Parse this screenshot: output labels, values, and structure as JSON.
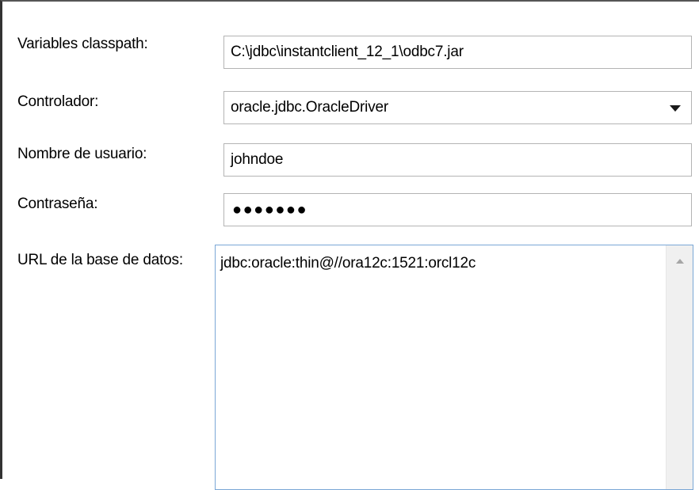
{
  "form": {
    "classpath": {
      "label": "Variables classpath:",
      "value": "C:\\jdbc\\instantclient_12_1\\odbc7.jar"
    },
    "driver": {
      "label": "Controlador:",
      "value": "oracle.jdbc.OracleDriver",
      "dropdown_icon": "chevron-down-icon"
    },
    "username": {
      "label": "Nombre de usuario:",
      "value": "johndoe"
    },
    "password": {
      "label": "Contraseña:",
      "masked_value": "●●●●●●●"
    },
    "database_url": {
      "label": "URL de la base de datos:",
      "value": "jdbc:oracle:thin@//ora12c:1521:orcl12c",
      "scroll_icon": "scroll-up-icon"
    }
  },
  "colors": {
    "field_border": "#b4b4b4",
    "focus_border": "#7aa7d6",
    "scrollbar_bg": "#f0f0f0"
  }
}
